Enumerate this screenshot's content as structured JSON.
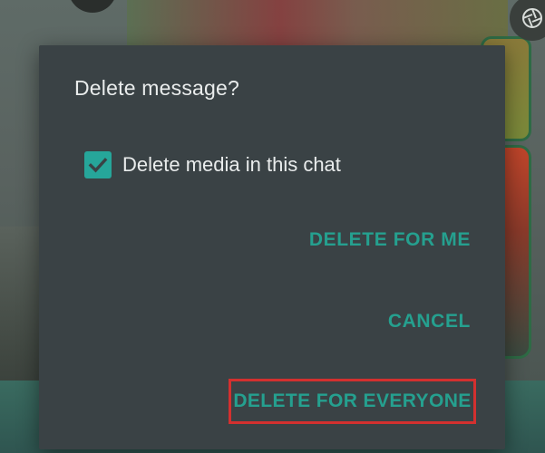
{
  "dialog": {
    "title": "Delete message?",
    "checkbox": {
      "label": "Delete media in this chat",
      "checked": true
    },
    "actions": {
      "delete_for_me": "DELETE FOR ME",
      "cancel": "CANCEL",
      "delete_for_everyone": "DELETE FOR EVERYONE"
    },
    "highlight_color": "#d3302f"
  },
  "colors": {
    "accent": "#25a08f",
    "dialog_bg": "#3a4245",
    "text": "#e9ecec"
  },
  "icons": {
    "checkbox": "check-icon",
    "top_right": "camera-shutter-icon"
  }
}
